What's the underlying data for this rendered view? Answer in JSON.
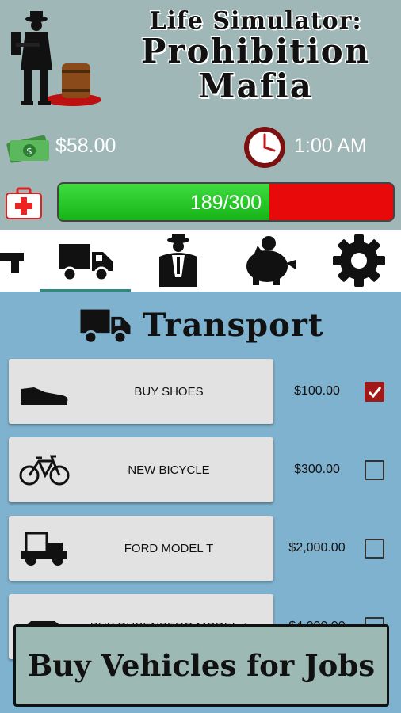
{
  "header": {
    "title_line1": "Life Simulator:",
    "title_line2": "Prohibition",
    "title_line3": "Mafia",
    "money": "$58.00",
    "time": "1:00 AM",
    "health": {
      "text": "189/300",
      "current": 189,
      "max": 300
    },
    "colors": {
      "health_good": "#17b417",
      "health_bad": "#e80a0a"
    }
  },
  "tabs": [
    {
      "icon": "gun-icon",
      "active": false
    },
    {
      "icon": "truck-icon",
      "active": true
    },
    {
      "icon": "mob-boss-icon",
      "active": false
    },
    {
      "icon": "piggy-bank-icon",
      "active": false
    },
    {
      "icon": "gear-icon",
      "active": false
    }
  ],
  "section": {
    "title": "Transport",
    "icon": "truck-icon"
  },
  "items": [
    {
      "label": "BUY SHOES",
      "price": "$100.00",
      "checked": true,
      "icon": "shoe-icon"
    },
    {
      "label": "NEW BICYCLE",
      "price": "$300.00",
      "checked": false,
      "icon": "bicycle-icon"
    },
    {
      "label": "FORD MODEL T",
      "price": "$2,000.00",
      "checked": false,
      "icon": "car-icon"
    },
    {
      "label": "BUY DUSENBERG MODEL J",
      "price": "$4,000.00",
      "checked": false,
      "icon": "car-icon"
    }
  ],
  "banner": {
    "text": "Buy Vehicles for Jobs"
  }
}
